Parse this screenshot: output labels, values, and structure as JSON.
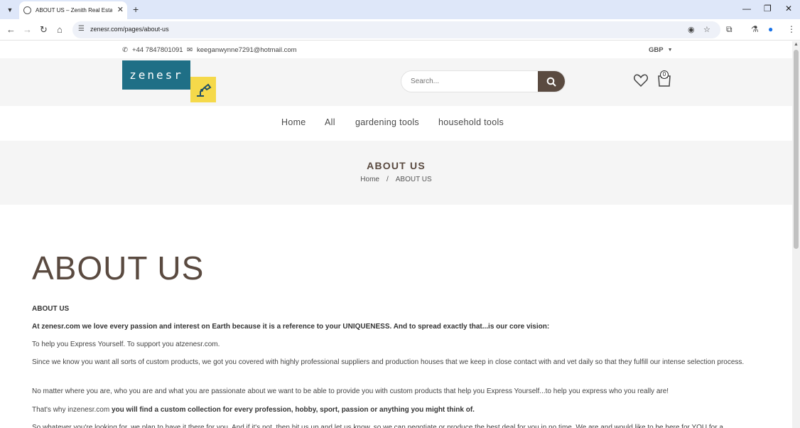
{
  "browser": {
    "tab_title": "ABOUT US – Zenith Real Estate",
    "url": "zenesr.com/pages/about-us",
    "new_tab": "+",
    "close_tab": "✕"
  },
  "topbar": {
    "phone": "+44 7847801091",
    "email": "keeganwynne7291@hotmail.com",
    "currency": "GBP"
  },
  "header": {
    "logo_text": "zenesr",
    "search_placeholder": "Search...",
    "cart_count": "0"
  },
  "nav": {
    "items": [
      "Home",
      "All",
      "gardening tools",
      "household tools"
    ]
  },
  "banner": {
    "title": "ABOUT US",
    "crumb_home": "Home",
    "crumb_sep": "/",
    "crumb_current": "ABOUT US"
  },
  "content": {
    "heading": "ABOUT US",
    "sub": "ABOUT US",
    "p1": "At zenesr.com we love every passion and interest on Earth because it is a reference to your UNIQUENESS. And to spread exactly that...is our core vision:",
    "p2": "To help you Express Yourself. To support you atzenesr.com.",
    "p3": "Since we know you want all sorts of custom products, we got you covered with highly professional suppliers and production houses that we keep in close contact with and vet daily so that they fulfill our intense selection process.",
    "p4": "No matter where you are, who you are and what you are passionate about we want to be able to provide you with custom products that help you Express Yourself...to help you express who you really are!",
    "p5_normal": "That's why inzenesr.com ",
    "p5_bold": "you will find a custom collection for every profession, hobby, sport, passion or anything you might think of.",
    "p6": "So whatever you're looking for, we plan to have it there for you. And if it's not, then hit us up and let us know, so we can negotiate or produce the best deal for you in no time. We are and would like to be here for YOU for a"
  },
  "colors": {
    "brand": "#5a4a40",
    "logo_blue": "#1f6f86",
    "logo_yellow": "#f5d94a"
  }
}
